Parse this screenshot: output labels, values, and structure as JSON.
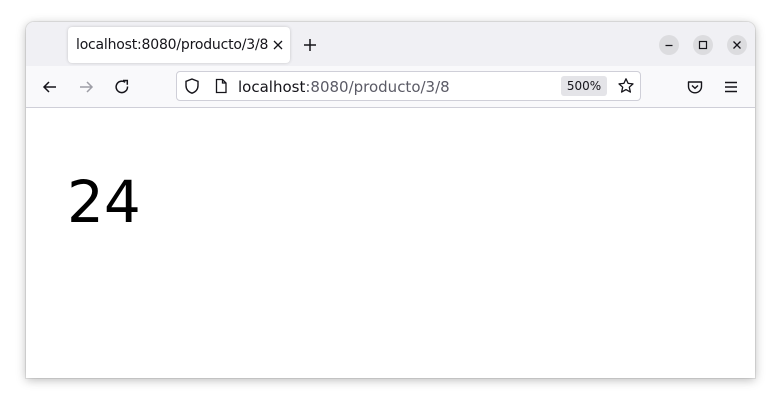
{
  "tab": {
    "title": "localhost:8080/producto/3/8"
  },
  "url": {
    "host": "localhost",
    "path": ":8080/producto/3/8",
    "zoom": "500%"
  },
  "page": {
    "value": "24"
  },
  "icons": {
    "back": "arrow-left-icon",
    "forward": "arrow-right-icon",
    "reload": "reload-icon",
    "shield": "shield-icon",
    "page": "page-icon",
    "bookmark": "star-icon",
    "pocket": "pocket-icon",
    "menu": "hamburger-menu-icon"
  }
}
